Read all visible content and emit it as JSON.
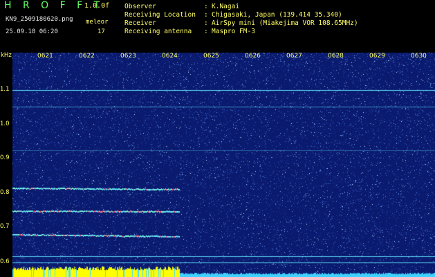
{
  "header": {
    "brand": "H R O F F T",
    "version": "1.0.0f",
    "filename": "KN9_2509180620.png",
    "datetime": "25.09.18 06:20",
    "tool": "meleor",
    "count": "17",
    "info": [
      {
        "label": "Observer",
        "value": "K.Nagai"
      },
      {
        "label": "Receiving Location",
        "value": "Chigasaki, Japan (139.414 35.340)"
      },
      {
        "label": "Receiver",
        "value": "AirSpy mini (Miakejima VOR 108.65MHz)"
      },
      {
        "label": "Receiving antenna",
        "value": "Maspro FM-3"
      }
    ]
  },
  "spectrogram": {
    "y_unit": "kHz",
    "y_ticks": [
      "1.1",
      "1.0",
      "0.9",
      "0.8",
      "0.7",
      "0.6"
    ],
    "x_ticks": [
      "0621",
      "0622",
      "0623",
      "0624",
      "0625",
      "0626",
      "0627",
      "0628",
      "0629",
      "0630"
    ],
    "colors": {
      "background": "#0a1a6e",
      "line": "#5fe8ff",
      "signal": "#ffff00",
      "label": "#ffff66"
    }
  }
}
